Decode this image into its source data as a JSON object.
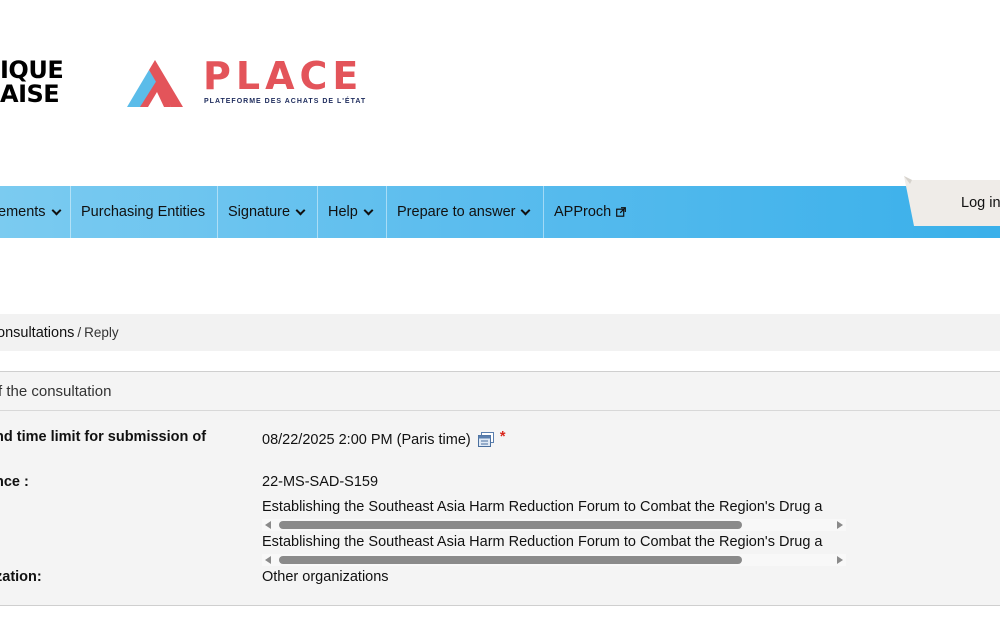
{
  "header": {
    "gov_logo_lines": [
      "IQUE",
      "AISE"
    ],
    "place_title": "PLACE",
    "place_subtitle": "PLATEFORME DES ACHATS DE L'ÉTAT",
    "brand_colors": {
      "place_red": "#e3545a",
      "place_blue": "#5bbce9",
      "navy": "#1d2b5c"
    }
  },
  "nav": {
    "items": [
      {
        "label": "ements",
        "has_dropdown": true
      },
      {
        "label": "Purchasing Entities",
        "has_dropdown": false
      },
      {
        "label": "Signature",
        "has_dropdown": true
      },
      {
        "label": "Help",
        "has_dropdown": true
      },
      {
        "label": "Prepare to answer",
        "has_dropdown": true
      },
      {
        "label": "APProch",
        "has_dropdown": false,
        "external": true
      }
    ],
    "login_label": "Log in",
    "bar_color": "#5cbdee"
  },
  "breadcrumb": {
    "parent": "onsultations",
    "separator": "/",
    "current": "Reply"
  },
  "panel": {
    "title": "f the consultation",
    "rows": [
      {
        "label": "nd time limit for submission of",
        "value": "08/22/2025 2:00 PM (Paris time)",
        "required_mark": "*"
      },
      {
        "label": "nce :",
        "value": "22-MS-SAD-S159"
      },
      {
        "label": ":",
        "value": "Establishing the Southeast Asia Harm Reduction Forum to Combat the Region's Drug a"
      },
      {
        "label": " :",
        "value": "Establishing the Southeast Asia Harm Reduction Forum to Combat the Region's Drug a"
      },
      {
        "label": "zation:",
        "value": "Other organizations"
      }
    ]
  }
}
